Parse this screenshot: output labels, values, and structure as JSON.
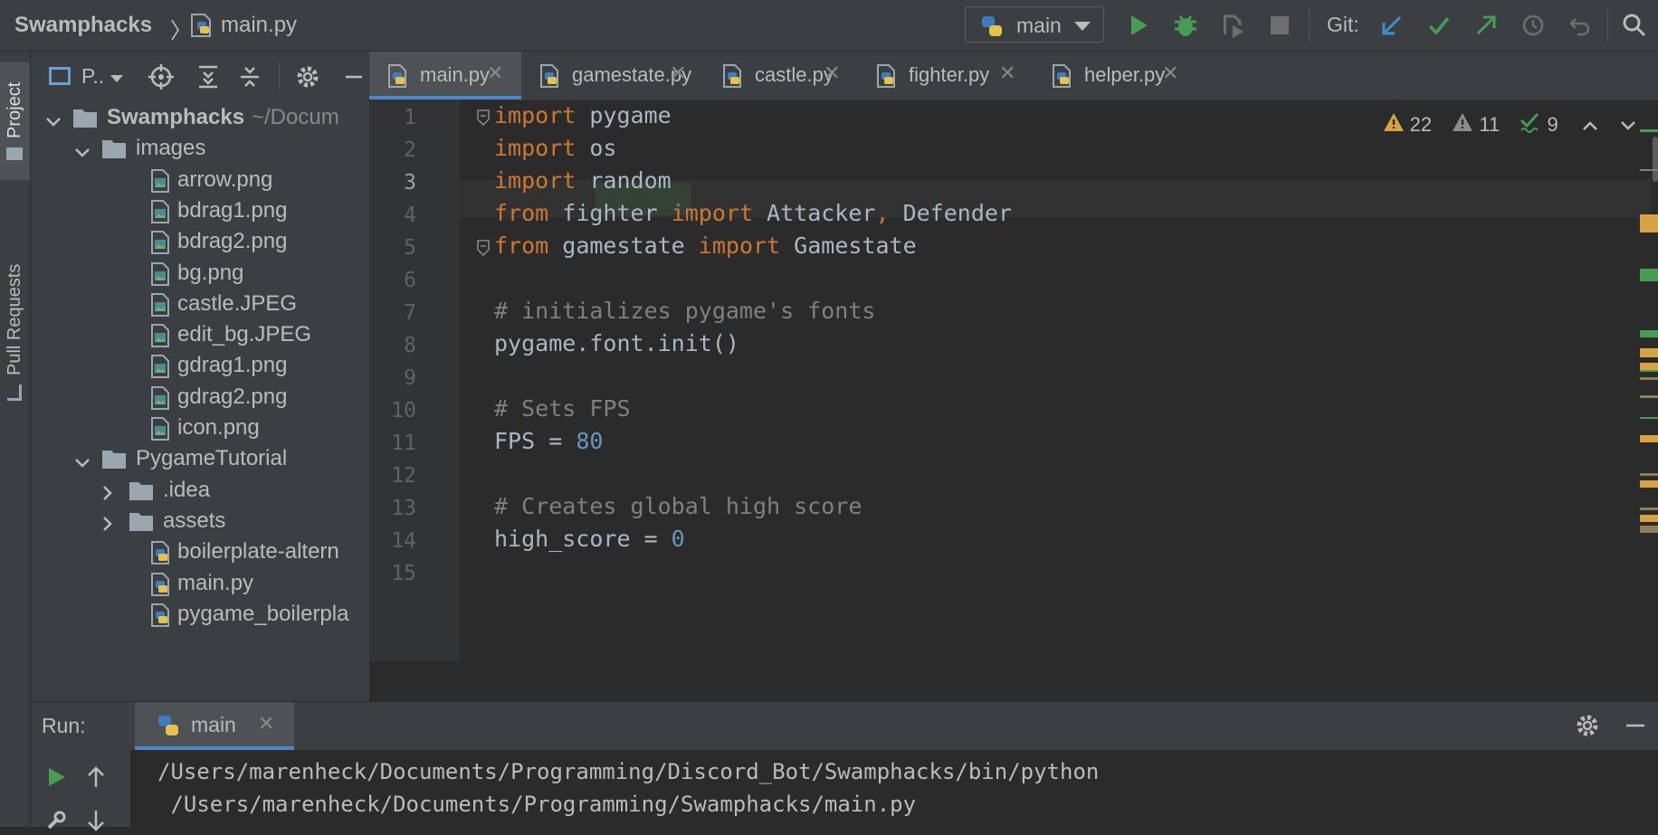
{
  "toolbar": {
    "project_name": "Swamphacks",
    "separator": "〉",
    "current_file": "main.py",
    "run_config": "main",
    "git_label": "Git:"
  },
  "left_strip": {
    "project_tab": "Project",
    "pull_requests_tab": "Pull Requests"
  },
  "project_panel": {
    "view_label": "P..",
    "tree": [
      {
        "name": "Swamphacks",
        "sub": "~/Docum",
        "type": "folder",
        "expanded": true,
        "depth": 0
      },
      {
        "name": "images",
        "type": "folder",
        "expanded": true,
        "depth": 1
      },
      {
        "name": "arrow.png",
        "type": "image",
        "depth": 2
      },
      {
        "name": "bdrag1.png",
        "type": "image",
        "depth": 2
      },
      {
        "name": "bdrag2.png",
        "type": "image",
        "depth": 2
      },
      {
        "name": "bg.png",
        "type": "image",
        "depth": 2
      },
      {
        "name": "castle.JPEG",
        "type": "image",
        "depth": 2
      },
      {
        "name": "edit_bg.JPEG",
        "type": "image",
        "depth": 2
      },
      {
        "name": "gdrag1.png",
        "type": "image",
        "depth": 2
      },
      {
        "name": "gdrag2.png",
        "type": "image",
        "depth": 2
      },
      {
        "name": "icon.png",
        "type": "image",
        "depth": 2
      },
      {
        "name": "PygameTutorial",
        "type": "folder",
        "expanded": true,
        "depth": 1
      },
      {
        "name": ".idea",
        "type": "folder",
        "expanded": false,
        "depth": 2
      },
      {
        "name": "assets",
        "type": "folder",
        "expanded": false,
        "depth": 2
      },
      {
        "name": "boilerplate-altern",
        "type": "python",
        "depth": 2
      },
      {
        "name": "main.py",
        "type": "python",
        "depth": 2
      },
      {
        "name": "pygame_boilerpla",
        "type": "python",
        "depth": 2
      }
    ]
  },
  "editor_tabs": [
    {
      "name": "main.py",
      "active": true
    },
    {
      "name": "gamestate.py",
      "active": false
    },
    {
      "name": "castle.py",
      "active": false
    },
    {
      "name": "fighter.py",
      "active": false
    },
    {
      "name": "helper.py",
      "active": false
    }
  ],
  "inspections": {
    "warnings": "22",
    "weak_warnings": "11",
    "typos": "9"
  },
  "editor": {
    "current_line": 3,
    "lines": [
      {
        "n": "1",
        "tokens": [
          [
            "kw",
            "import"
          ],
          [
            "p",
            " pygame"
          ]
        ]
      },
      {
        "n": "2",
        "tokens": [
          [
            "kw",
            "import"
          ],
          [
            "p",
            " os"
          ]
        ]
      },
      {
        "n": "3",
        "tokens": [
          [
            "kw",
            "import"
          ],
          [
            "p",
            " random"
          ]
        ]
      },
      {
        "n": "4",
        "tokens": [
          [
            "kw",
            "from"
          ],
          [
            "p",
            " fighter "
          ],
          [
            "kw",
            "import"
          ],
          [
            "p",
            " Attacker"
          ],
          [
            "kw",
            ","
          ],
          [
            "p",
            " Defender"
          ]
        ]
      },
      {
        "n": "5",
        "tokens": [
          [
            "kw",
            "from"
          ],
          [
            "p",
            " gamestate "
          ],
          [
            "kw",
            "import"
          ],
          [
            "p",
            " Gamestate"
          ]
        ]
      },
      {
        "n": "6",
        "tokens": []
      },
      {
        "n": "7",
        "tokens": [
          [
            "cm",
            "# initializes pygame's fonts"
          ]
        ]
      },
      {
        "n": "8",
        "tokens": [
          [
            "p",
            "pygame.font.init()"
          ]
        ]
      },
      {
        "n": "9",
        "tokens": []
      },
      {
        "n": "10",
        "tokens": [
          [
            "cm",
            "# Sets FPS"
          ]
        ]
      },
      {
        "n": "11",
        "tokens": [
          [
            "p",
            "FPS = "
          ],
          [
            "num",
            "80"
          ]
        ]
      },
      {
        "n": "12",
        "tokens": []
      },
      {
        "n": "13",
        "tokens": [
          [
            "cm",
            "# Creates global high score"
          ]
        ]
      },
      {
        "n": "14",
        "tokens": [
          [
            "p",
            "high_score = "
          ],
          [
            "num",
            "0"
          ]
        ]
      },
      {
        "n": "15",
        "tokens": []
      }
    ]
  },
  "run_panel": {
    "label": "Run:",
    "tab": "main",
    "console_lines": [
      "/Users/marenheck/Documents/Programming/Discord_Bot/Swamphacks/bin/python",
      " /Users/marenheck/Documents/Programming/Swamphacks/main.py"
    ]
  },
  "colors": {
    "background": "#2b2b2b",
    "panel": "#3c3f41",
    "keyword": "#cc7832",
    "comment": "#808080",
    "number": "#6897bb",
    "accent": "#4a88c7",
    "run_green": "#499c54",
    "warning": "#d9a343"
  }
}
